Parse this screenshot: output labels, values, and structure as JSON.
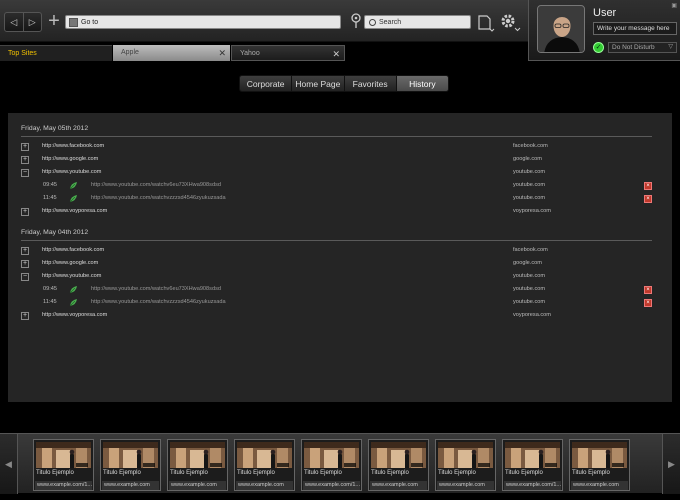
{
  "toolbar": {
    "back_icon": "chevron-left-icon",
    "forward_icon": "chevron-right-icon",
    "new_tab_icon": "plus-icon",
    "url_text": "Go to",
    "search_text": "Search"
  },
  "user": {
    "name": "User",
    "message_placeholder": "Write your message here",
    "status": "Do Not Disturb",
    "status_color": "#33cc33"
  },
  "tabs": [
    {
      "label": "Top Sites"
    },
    {
      "label": "Apple"
    },
    {
      "label": "Yahoo"
    }
  ],
  "segments": [
    {
      "label": "Corporate"
    },
    {
      "label": "Home Page"
    },
    {
      "label": "Favorites"
    },
    {
      "label": "History",
      "active": true
    }
  ],
  "history": {
    "groups": [
      {
        "date": "Friday, May 05th 2012",
        "rows": [
          {
            "type": "site",
            "expand": "+",
            "url": "http://www.facebook.com",
            "domain": "facebook.com"
          },
          {
            "type": "site",
            "expand": "+",
            "url": "http://www.google.com",
            "domain": "google.com"
          },
          {
            "type": "site",
            "expand": "−",
            "url": "http://www.youtube.com",
            "domain": "youtube.com"
          },
          {
            "type": "visit",
            "time": "09:45",
            "url": "http://www.youtube.com/watchv6eu73XHwa908sdsd",
            "domain": "youtube.com"
          },
          {
            "type": "visit",
            "time": "11:45",
            "url": "http://www.youtube.com/watchvzzzsd4546zyukuzsada",
            "domain": "youtube.com"
          },
          {
            "type": "site",
            "expand": "+",
            "url": "http://www.voyporesa.com",
            "domain": "voyporesa.com"
          }
        ]
      },
      {
        "date": "Friday, May 04th 2012",
        "rows": [
          {
            "type": "site",
            "expand": "+",
            "url": "http://www.facebook.com",
            "domain": "facebook.com"
          },
          {
            "type": "site",
            "expand": "+",
            "url": "http://www.google.com",
            "domain": "google.com"
          },
          {
            "type": "site",
            "expand": "−",
            "url": "http://www.youtube.com",
            "domain": "youtube.com"
          },
          {
            "type": "visit",
            "time": "09:45",
            "url": "http://www.youtube.com/watchv6eu73XHwa908sdsd",
            "domain": "youtube.com"
          },
          {
            "type": "visit",
            "time": "11:45",
            "url": "http://www.youtube.com/watchvzzzsd4546zyukuzsada",
            "domain": "youtube.com"
          },
          {
            "type": "site",
            "expand": "+",
            "url": "http://www.voyporesa.com",
            "domain": "voyporesa.com"
          }
        ]
      }
    ]
  },
  "thumbnails": [
    {
      "title": "Titulo Ejemplo",
      "url": "www.example.com/1..."
    },
    {
      "title": "Titulo Ejemplo",
      "url": "www.example.com"
    },
    {
      "title": "Titulo Ejemplo",
      "url": "www.example.com"
    },
    {
      "title": "Titulo Ejemplo",
      "url": "www.example.com"
    },
    {
      "title": "Titulo Ejemplo",
      "url": "www.example.com/1..."
    },
    {
      "title": "Titulo Ejemplo",
      "url": "www.example.com"
    },
    {
      "title": "Titulo Ejemplo",
      "url": "www.example.com"
    },
    {
      "title": "Titulo Ejemplo",
      "url": "www.example.com/1..."
    },
    {
      "title": "Titulo Ejemplo",
      "url": "www.example.com"
    }
  ]
}
